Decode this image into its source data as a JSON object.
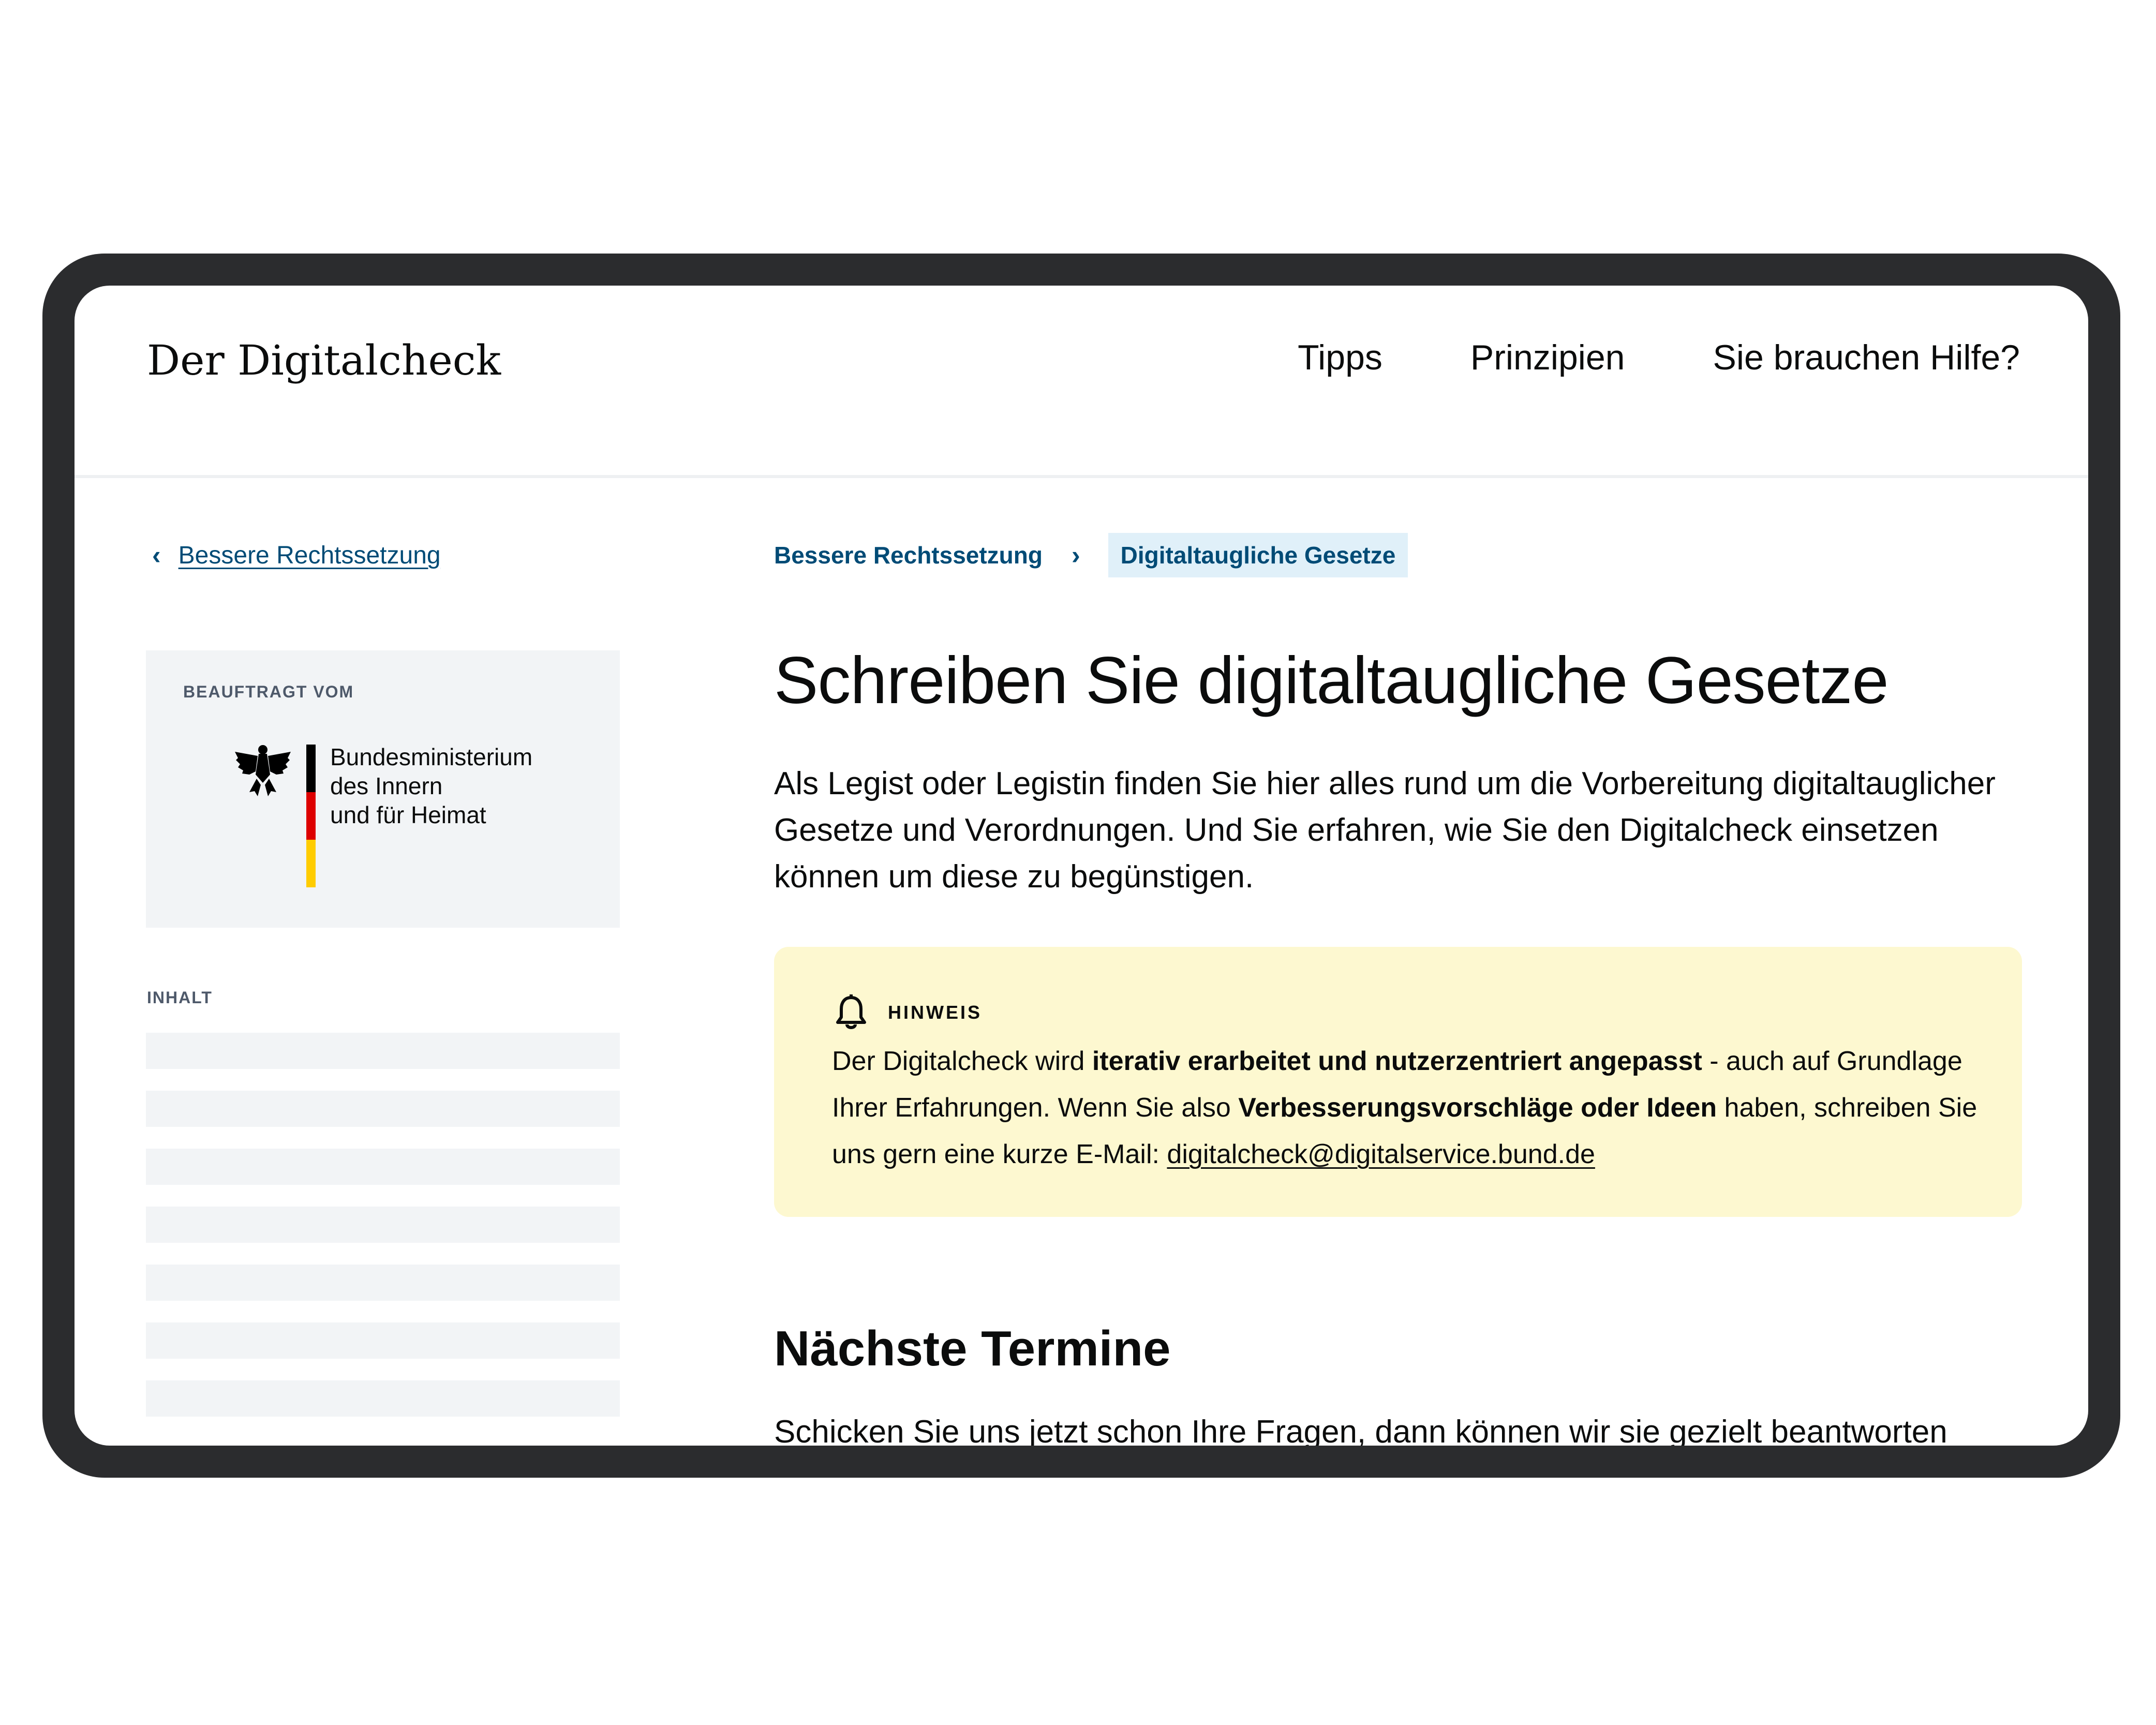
{
  "header": {
    "brand": "Der Digitalcheck",
    "nav": [
      "Tipps",
      "Prinzipien",
      "Sie brauchen Hilfe?"
    ]
  },
  "sidebar": {
    "back_link": "Bessere Rechtssetzung",
    "sponsor_caption": "BEAUFTRAGT VOM",
    "ministry_lines": [
      "Bundesministerium",
      "des Innern",
      "und für Heimat"
    ],
    "toc_label": "INHALT"
  },
  "breadcrumb": {
    "parent": "Bessere Rechtssetzung",
    "separator": "›",
    "current": "Digitaltaugliche Gesetze"
  },
  "main": {
    "title": "Schreiben Sie digitaltaugliche Gesetze",
    "intro": "Als Legist oder Legistin finden Sie hier alles rund um die Vorbereitung digitaltauglicher Gesetze und Verordnungen. Und Sie erfahren, wie Sie den Digitalcheck einsetzen können um diese zu begünstigen.",
    "hint": {
      "label": "HINWEIS",
      "text_1": "Der Digitalcheck wird ",
      "bold_1": "iterativ erarbeitet und nutzerzentriert angepasst",
      "text_2": " - auch auf Grundlage Ihrer Erfahrungen. Wenn Sie also ",
      "bold_2": "Verbesserungsvorschläge oder Ideen",
      "text_3": " haben, schreiben Sie uns gern eine kurze E-Mail: ",
      "email": "digitalcheck@digitalservice.bund.de"
    },
    "section_title": "Nächste Termine",
    "section_text": "Schicken Sie uns jetzt schon Ihre Fragen, dann können wir sie gezielt beantworten"
  },
  "colors": {
    "frame": "#2b2c2e",
    "link": "#004b76",
    "crumb_highlight": "#e0f0f9",
    "hint_bg": "#fdf8d0",
    "skeleton": "#f2f4f6"
  }
}
